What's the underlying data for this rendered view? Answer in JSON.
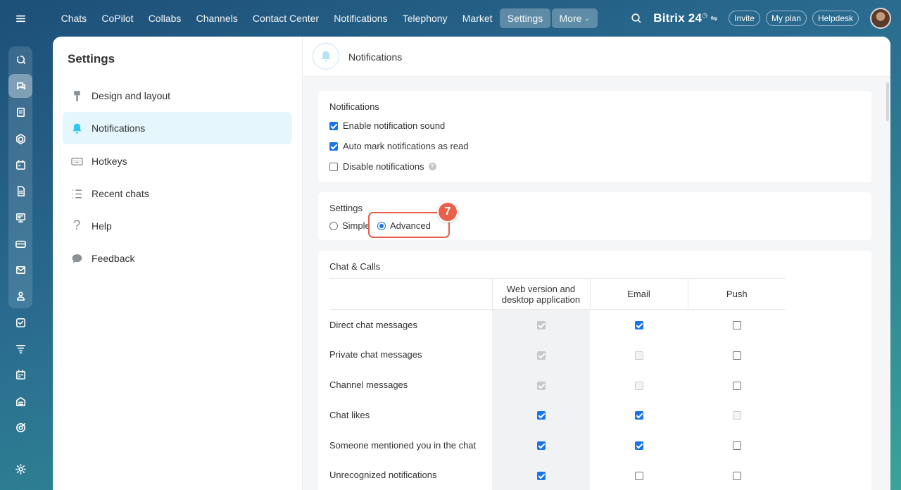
{
  "topnav": {
    "items": [
      "Chats",
      "CoPilot",
      "Collabs",
      "Channels",
      "Contact Center",
      "Notifications",
      "Telephony",
      "Market",
      "Settings"
    ],
    "more_label": "More",
    "active": "Settings"
  },
  "header": {
    "brand": "Bitrix 24",
    "invite_label": "Invite",
    "plan_label": "My plan",
    "helpdesk_label": "Helpdesk"
  },
  "leftbar": {
    "icons": [
      "menu-icon",
      "copilot-icon",
      "chats-icon",
      "feed-icon",
      "hexagon-icon",
      "calendar-icon",
      "document-icon",
      "board-icon",
      "card-icon",
      "mail-icon",
      "team-icon",
      "tasks-icon",
      "filter-icon",
      "schedule-icon",
      "store-icon",
      "target-icon",
      "settings-icon"
    ],
    "active": "chats-icon"
  },
  "sidebar": {
    "title": "Settings",
    "items": [
      {
        "label": "Design and layout",
        "icon": "brush-icon"
      },
      {
        "label": "Notifications",
        "icon": "bell-icon"
      },
      {
        "label": "Hotkeys",
        "icon": "keyboard-icon"
      },
      {
        "label": "Recent chats",
        "icon": "list-icon"
      },
      {
        "label": "Help",
        "icon": "question-icon"
      },
      {
        "label": "Feedback",
        "icon": "speech-bubble-icon"
      }
    ],
    "active": "Notifications"
  },
  "main": {
    "title": "Notifications",
    "notifications_card": {
      "title": "Notifications",
      "options": [
        {
          "label": "Enable notification sound",
          "checked": true
        },
        {
          "label": "Auto mark notifications as read",
          "checked": true
        },
        {
          "label": "Disable notifications",
          "checked": false
        }
      ]
    },
    "settings_card": {
      "title": "Settings",
      "simple_label": "Simple",
      "advanced_label": "Advanced",
      "selected": "Advanced",
      "step_badge": "7"
    },
    "chat_calls": {
      "title": "Chat & Calls",
      "columns": [
        "Web version and desktop application",
        "Email",
        "Push"
      ],
      "rows": [
        {
          "label": "Direct chat messages"
        },
        {
          "label": "Private chat messages"
        },
        {
          "label": "Channel messages"
        },
        {
          "label": "Chat likes"
        },
        {
          "label": "Someone mentioned you in the chat"
        },
        {
          "label": "Unrecognized notifications"
        }
      ]
    }
  },
  "colors": {
    "accent": "#1a73e8",
    "highlight": "#e8604c",
    "active_item": "#e5f6fd"
  }
}
